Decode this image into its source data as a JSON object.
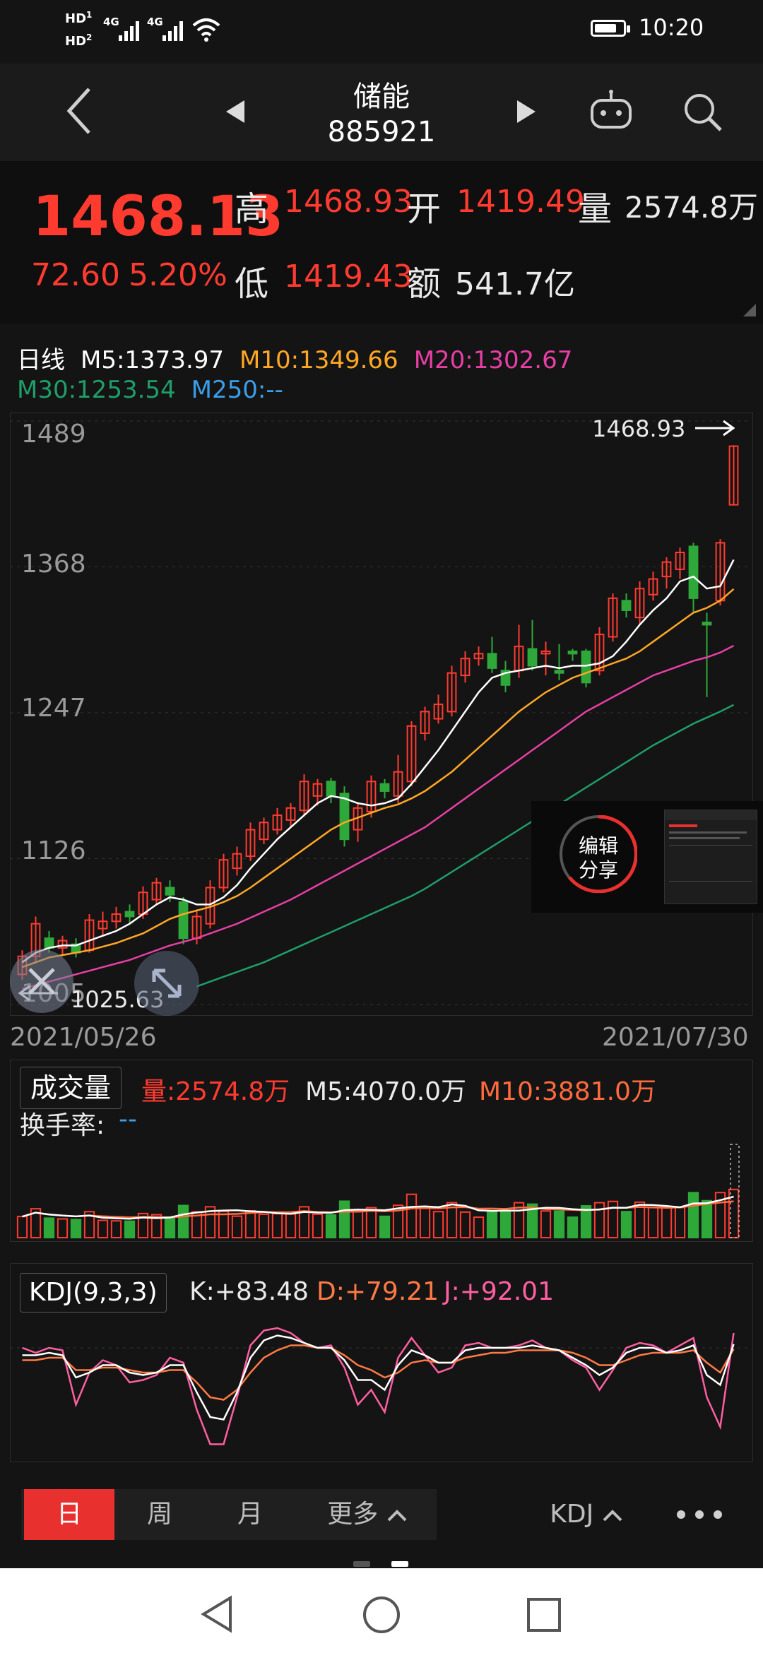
{
  "status_bar": {
    "time": "10:20",
    "net1": "4G",
    "net2": "4G",
    "hd1": "HD",
    "hd2": "HD",
    "sim1": "1",
    "sim2": "2",
    "battery_level": 0.8
  },
  "header": {
    "title": "储能",
    "code": "885921"
  },
  "quote": {
    "price": "1468.13",
    "change": "72.60",
    "change_pct": "5.20%",
    "high_label": "高",
    "high": "1468.93",
    "open_label": "开",
    "open": "1419.49",
    "volume_label": "量",
    "volume": "2574.8万",
    "low_label": "低",
    "low": "1419.43",
    "amount_label": "额",
    "amount": "541.7亿"
  },
  "kline": {
    "period": "日线",
    "m5": "M5:1373.97",
    "m10": "M10:1349.66",
    "m20": "M20:1302.67",
    "m30": "M30:1253.54",
    "m250": "M250:--",
    "y_ticks": [
      "1489",
      "1368",
      "1247",
      "1126",
      "1005"
    ],
    "max_label": "1468.93",
    "min_label": "1025.63",
    "date_start": "2021/05/26",
    "date_end": "2021/07/30",
    "share_label_1": "编辑",
    "share_label_2": "分享"
  },
  "volume": {
    "title": "成交量",
    "vol": "量:2574.8万",
    "m5": "M5:4070.0万",
    "m10": "M10:3881.0万",
    "turnover_label": "换手率:",
    "turnover": "--"
  },
  "kdj": {
    "title": "KDJ(9,3,3)",
    "k": "K:+83.48",
    "d": "D:+79.21",
    "j": "J:+92.01"
  },
  "tabs": {
    "day": "日",
    "week": "周",
    "month": "月",
    "more": "更多",
    "indicator": "KDJ"
  },
  "colors": {
    "up": "#ff3b30",
    "down": "#2fa83a",
    "m5": "#ffffff",
    "m10": "#ffa726",
    "m20": "#e83fa6",
    "m30": "#1f9e6a",
    "m250": "#3b9ee8",
    "accent": "#e8302f"
  },
  "chart_data": {
    "type": "candlestick",
    "title": "",
    "x_range": [
      "2021/05/26",
      "2021/07/30"
    ],
    "ylim": [
      1005,
      1489
    ],
    "high": 1468.93,
    "low": 1025.63,
    "candles": [
      [
        1030,
        1045,
        1025.63,
        1050
      ],
      [
        1045,
        1072,
        1040,
        1078
      ],
      [
        1060,
        1052,
        1048,
        1066
      ],
      [
        1052,
        1058,
        1045,
        1062
      ],
      [
        1055,
        1048,
        1044,
        1060
      ],
      [
        1050,
        1075,
        1048,
        1080
      ],
      [
        1068,
        1074,
        1062,
        1082
      ],
      [
        1074,
        1080,
        1068,
        1086
      ],
      [
        1082,
        1078,
        1072,
        1088
      ],
      [
        1080,
        1098,
        1076,
        1103
      ],
      [
        1092,
        1106,
        1088,
        1110
      ],
      [
        1102,
        1096,
        1090,
        1108
      ],
      [
        1090,
        1060,
        1055,
        1094
      ],
      [
        1060,
        1078,
        1055,
        1084
      ],
      [
        1072,
        1102,
        1068,
        1108
      ],
      [
        1102,
        1125,
        1098,
        1130
      ],
      [
        1118,
        1130,
        1112,
        1136
      ],
      [
        1128,
        1150,
        1124,
        1156
      ],
      [
        1142,
        1156,
        1138,
        1160
      ],
      [
        1150,
        1162,
        1146,
        1168
      ],
      [
        1158,
        1168,
        1152,
        1172
      ],
      [
        1166,
        1190,
        1162,
        1196
      ],
      [
        1178,
        1188,
        1170,
        1192
      ],
      [
        1190,
        1178,
        1172,
        1193
      ],
      [
        1180,
        1142,
        1136,
        1186
      ],
      [
        1150,
        1168,
        1140,
        1172
      ],
      [
        1165,
        1190,
        1160,
        1195
      ],
      [
        1188,
        1182,
        1176,
        1192
      ],
      [
        1178,
        1198,
        1172,
        1212
      ],
      [
        1190,
        1236,
        1186,
        1240
      ],
      [
        1230,
        1248,
        1224,
        1252
      ],
      [
        1242,
        1254,
        1238,
        1262
      ],
      [
        1248,
        1280,
        1244,
        1286
      ],
      [
        1278,
        1292,
        1272,
        1298
      ],
      [
        1292,
        1296,
        1286,
        1302
      ],
      [
        1296,
        1284,
        1280,
        1310
      ],
      [
        1282,
        1270,
        1264,
        1290
      ],
      [
        1282,
        1302,
        1276,
        1320
      ],
      [
        1300,
        1286,
        1282,
        1324
      ],
      [
        1296,
        1298,
        1278,
        1306
      ],
      [
        1282,
        1280,
        1274,
        1304
      ],
      [
        1298,
        1296,
        1290,
        1300
      ],
      [
        1298,
        1272,
        1268,
        1300
      ],
      [
        1282,
        1312,
        1278,
        1318
      ],
      [
        1310,
        1342,
        1306,
        1346
      ],
      [
        1340,
        1332,
        1326,
        1346
      ],
      [
        1326,
        1350,
        1320,
        1356
      ],
      [
        1345,
        1358,
        1340,
        1364
      ],
      [
        1360,
        1372,
        1350,
        1376
      ],
      [
        1366,
        1380,
        1358,
        1384
      ],
      [
        1385,
        1342,
        1330,
        1388
      ],
      [
        1322,
        1320,
        1260,
        1330
      ],
      [
        1340,
        1388,
        1336,
        1391
      ],
      [
        1419.49,
        1468.13,
        1419.43,
        1468.93
      ]
    ],
    "series": [
      {
        "name": "M5",
        "values": [
          1040,
          1048,
          1052,
          1054,
          1054,
          1058,
          1062,
          1066,
          1072,
          1080,
          1088,
          1094,
          1092,
          1088,
          1088,
          1094,
          1104,
          1118,
          1130,
          1142,
          1152,
          1162,
          1172,
          1178,
          1176,
          1172,
          1170,
          1172,
          1176,
          1188,
          1202,
          1216,
          1232,
          1248,
          1264,
          1276,
          1280,
          1282,
          1284,
          1286,
          1284,
          1286,
          1286,
          1288,
          1294,
          1306,
          1320,
          1332,
          1342,
          1356,
          1360,
          1350,
          1352,
          1374
        ]
      },
      {
        "name": "M10",
        "values": [
          1036,
          1040,
          1044,
          1046,
          1048,
          1050,
          1053,
          1056,
          1060,
          1064,
          1070,
          1076,
          1080,
          1083,
          1086,
          1090,
          1095,
          1102,
          1110,
          1118,
          1126,
          1134,
          1142,
          1150,
          1156,
          1160,
          1164,
          1168,
          1171,
          1176,
          1182,
          1190,
          1198,
          1208,
          1218,
          1228,
          1238,
          1248,
          1256,
          1264,
          1270,
          1276,
          1280,
          1284,
          1288,
          1292,
          1298,
          1306,
          1314,
          1322,
          1330,
          1334,
          1340,
          1349.66
        ]
      },
      {
        "name": "M20",
        "values": [
          1018,
          1021,
          1024,
          1027,
          1030,
          1033,
          1036,
          1039,
          1042,
          1046,
          1050,
          1054,
          1057,
          1060,
          1064,
          1068,
          1072,
          1077,
          1082,
          1087,
          1092,
          1098,
          1104,
          1110,
          1116,
          1122,
          1128,
          1134,
          1140,
          1146,
          1152,
          1160,
          1168,
          1176,
          1184,
          1192,
          1200,
          1208,
          1216,
          1224,
          1232,
          1240,
          1248,
          1254,
          1260,
          1266,
          1272,
          1278,
          1282,
          1286,
          1290,
          1293,
          1297,
          1302.67
        ]
      },
      {
        "name": "M30",
        "values": [
          null,
          null,
          null,
          null,
          null,
          null,
          null,
          null,
          null,
          null,
          null,
          null,
          null,
          1020,
          1024,
          1028,
          1032,
          1036,
          1040,
          1045,
          1050,
          1055,
          1060,
          1065,
          1070,
          1075,
          1080,
          1085,
          1090,
          1095,
          1101,
          1108,
          1115,
          1122,
          1129,
          1136,
          1143,
          1150,
          1157,
          1164,
          1171,
          1178,
          1185,
          1192,
          1199,
          1206,
          1213,
          1220,
          1226,
          1232,
          1238,
          1243,
          1248,
          1253.54
        ]
      }
    ]
  }
}
